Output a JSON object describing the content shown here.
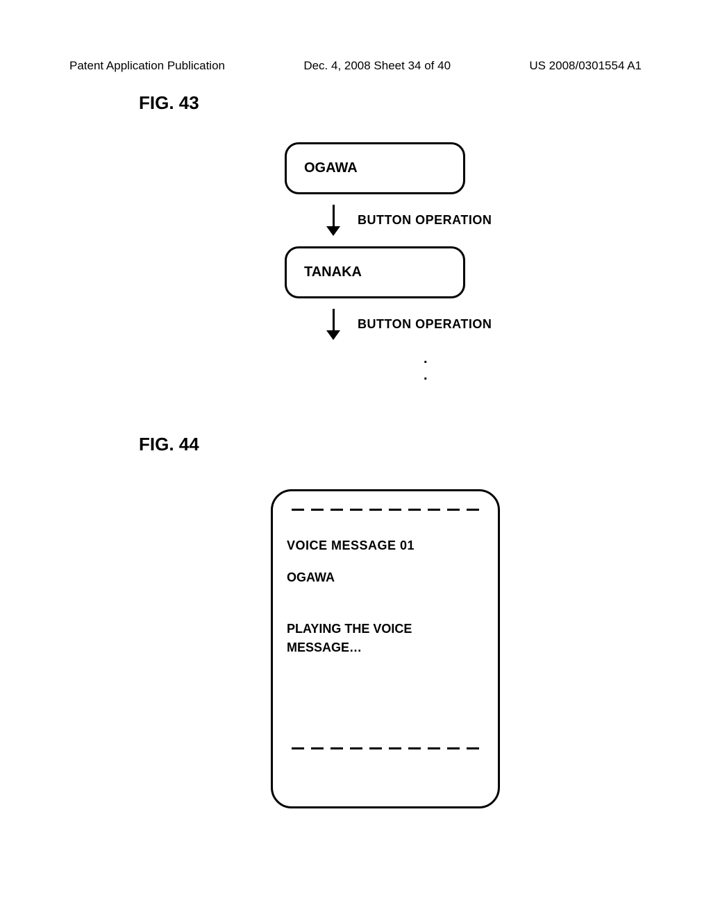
{
  "header": {
    "left": "Patent Application Publication",
    "center": "Dec. 4, 2008  Sheet 34 of 40",
    "right": "US 2008/0301554 A1"
  },
  "fig43": {
    "label": "FIG. 43",
    "box1": "OGAWA",
    "arrow1_label": "BUTTON OPERATION",
    "box2": "TANAKA",
    "arrow2_label": "BUTTON OPERATION"
  },
  "fig44": {
    "label": "FIG. 44",
    "line1": "VOICE MESSAGE 01",
    "line2": "OGAWA",
    "line3": "PLAYING THE VOICE MESSAGE…"
  }
}
